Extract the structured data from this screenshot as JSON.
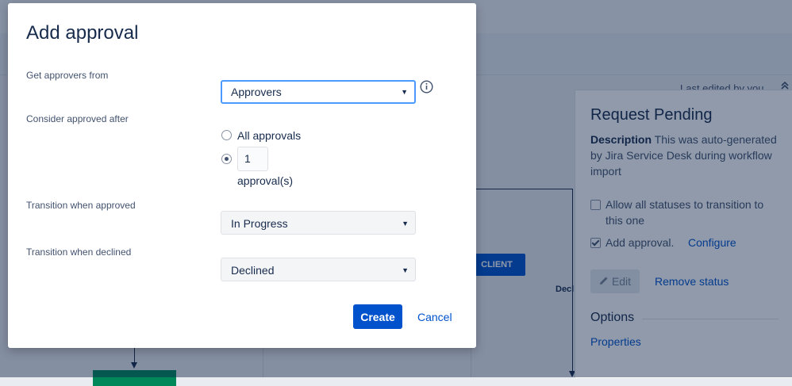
{
  "header": {
    "last_edited": "Last edited by you,",
    "collapse_icon": "double-chevron-up-icon"
  },
  "diagram": {
    "client_label": "CLIENT",
    "declined_label": "Decl",
    "accent": "#0052cc",
    "green": "#00875a"
  },
  "panel": {
    "title": "Request Pending",
    "description_label": "Description",
    "description_text": " This was auto-generated by Jira Service Desk during workflow import",
    "allow_all_label": "Allow all statuses to transition to this one",
    "allow_all_checked": false,
    "add_approval_label": "Add approval.",
    "add_approval_checked": true,
    "configure_link": "Configure",
    "edit_label": "Edit",
    "edit_icon": "pencil-icon",
    "remove_status": "Remove status",
    "options_heading": "Options",
    "properties_link": "Properties"
  },
  "modal": {
    "title": "Add approval",
    "get_approvers_label": "Get approvers from",
    "get_approvers_value": "Approvers",
    "info_icon": "info-icon",
    "consider_label": "Consider approved after",
    "all_approvals_label": "All approvals",
    "all_approvals_selected": false,
    "count_selected": true,
    "count_value": "1",
    "count_suffix": "approval(s)",
    "approved_label": "Transition when approved",
    "approved_value": "In Progress",
    "declined_label": "Transition when declined",
    "declined_value": "Declined",
    "create_label": "Create",
    "cancel_label": "Cancel"
  }
}
